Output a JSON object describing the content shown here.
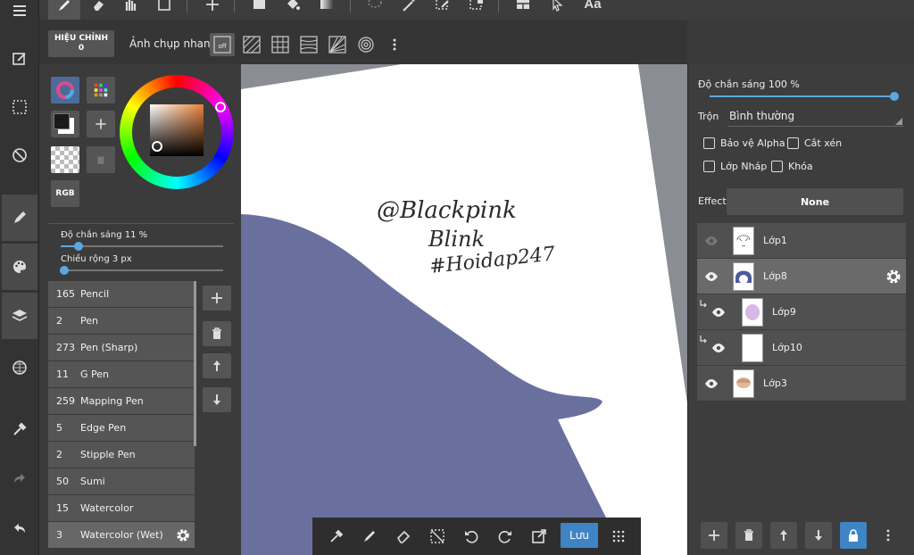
{
  "subtoolbar": {
    "hieu_chinh_label": "HIỆU CHỈNH",
    "hieu_chinh_value": "0",
    "snap_label": "Ảnh chụp nhanh",
    "snap_off_label": "off"
  },
  "brush_panel": {
    "rgb_label": "RGB",
    "opacity_label": "Độ chắn sáng  11  %",
    "opacity_value": 0.11,
    "width_label": "Chiều rộng  3  px",
    "width_value": 0.02,
    "brushes": [
      {
        "size": "165",
        "name": "Pencil"
      },
      {
        "size": "2",
        "name": "Pen"
      },
      {
        "size": "273",
        "name": "Pen (Sharp)"
      },
      {
        "size": "11",
        "name": "G Pen"
      },
      {
        "size": "259",
        "name": "Mapping Pen"
      },
      {
        "size": "5",
        "name": "Edge Pen"
      },
      {
        "size": "2",
        "name": "Stipple Pen"
      },
      {
        "size": "50",
        "name": "Sumi"
      },
      {
        "size": "15",
        "name": "Watercolor"
      },
      {
        "size": "3",
        "name": "Watercolor (Wet)"
      }
    ],
    "selected_brush_index": 9
  },
  "canvas": {
    "handwriting_line1": "@Blackpink",
    "handwriting_line2": "Blink",
    "handwriting_line3": "#Hoidap247",
    "fill_color": "#6a709e"
  },
  "bottom_bar": {
    "save_label": "Lưu"
  },
  "layer_panel": {
    "opacity_label": "Độ chắn sáng  100  %",
    "opacity_value": 1.0,
    "blend_label": "Trộn",
    "blend_value": "Bình thường",
    "alpha_protect_label": "Bảo vệ Alpha",
    "clipping_label": "Cắt xén",
    "draft_label": "Lớp Nháp",
    "lock_label": "Khóa",
    "effect_label": "Effect",
    "effect_value": "None",
    "layers": [
      {
        "name": "Lớp1"
      },
      {
        "name": "Lớp8"
      },
      {
        "name": "Lớp9"
      },
      {
        "name": "Lớp10"
      },
      {
        "name": "Lớp3"
      }
    ]
  },
  "colors": {
    "accent": "#3f84c4",
    "slider": "#5aa8e0"
  }
}
